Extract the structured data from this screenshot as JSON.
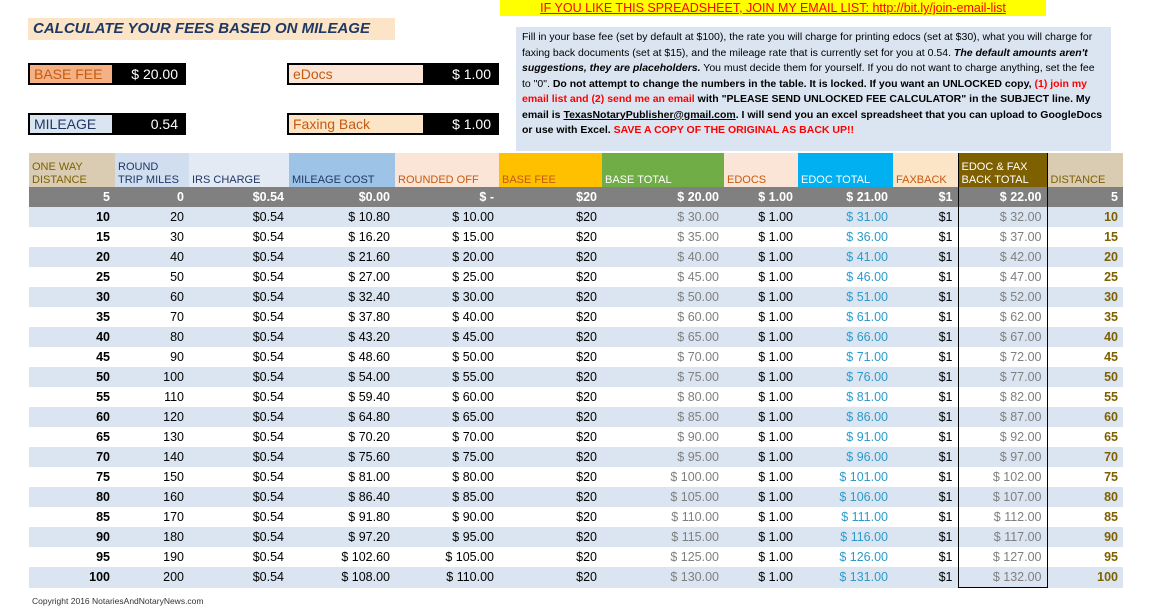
{
  "banner": "IF YOU LIKE THIS SPREADSHEET, JOIN MY EMAIL LIST:  http://bit.ly/join-email-list",
  "title": "CALCULATE YOUR FEES BASED ON MILEAGE",
  "inputs": {
    "base_fee": {
      "label": "BASE FEE",
      "value": "$ 20.00",
      "label_bg": "#f4b183",
      "label_color": "#c55a11"
    },
    "edocs": {
      "label": "eDocs",
      "value": "$ 1.00",
      "label_bg": "#fbe5d6",
      "label_color": "#c55a11"
    },
    "mileage": {
      "label": "MILEAGE",
      "value": "0.54",
      "label_bg": "#dbe5f1",
      "label_color": "#1f3864"
    },
    "faxing_back": {
      "label": "Faxing Back",
      "value": "$ 1.00",
      "label_bg": "#fce4c6",
      "label_color": "#c55a11"
    }
  },
  "description": {
    "p1": "Fill in your base fee (set by default at $100), the rate you will charge for printing edocs (set at $30), what you will charge for faxing back documents (set at $15), and the mileage rate that is currently set for you at 0.54.",
    "p2": "The default amounts aren't suggestions, they are placeholders.",
    "p3": "You must decide them for yourself. If you do not want to charge anything, set the fee to \"0\".",
    "p4": "Do not attempt to change the numbers in the table.  It is locked. If you want an UNLOCKED copy,",
    "p5": "(1) join my email list and (2) send me an email",
    "p6": "with \"PLEASE SEND UNLOCKED FEE CALCULATOR\" in the SUBJECT line. My email is",
    "email": "TexasNotaryPublisher@gmail.com",
    "p7": ".  I will send you an excel spreadsheet that you can upload to GoogleDocs or use with Excel.",
    "p8": "SAVE A COPY OF THE ORIGINAL AS BACK UP!!"
  },
  "table": {
    "headers": [
      {
        "label": "ONE WAY DISTANCE",
        "bg": "#d9ccb3",
        "color": "#7f6000"
      },
      {
        "label": "ROUND TRIP MILES",
        "bg": "#d0def0",
        "color": "#1f3864"
      },
      {
        "label": "IRS CHARGE",
        "bg": "#e4eaf4",
        "color": "#1f3864"
      },
      {
        "label": "MILEAGE COST",
        "bg": "#9dc3e6",
        "color": "#1f3864"
      },
      {
        "label": "ROUNDED OFF",
        "bg": "#fbe5d6",
        "color": "#c55a11"
      },
      {
        "label": "BASE FEE",
        "bg": "#ffc000",
        "color": "#c55a11"
      },
      {
        "label": "BASE TOTAL",
        "bg": "#70ad47",
        "color": "#ffffff"
      },
      {
        "label": "EDOCS",
        "bg": "#fbe5d6",
        "color": "#c55a11"
      },
      {
        "label": "EDOC TOTAL",
        "bg": "#00b0f0",
        "color": "#ffffff"
      },
      {
        "label": "FAXBACK",
        "bg": "#fce4c6",
        "color": "#c55a11"
      },
      {
        "label": "EDOC & FAX BACK TOTAL",
        "bg": "#7f6000",
        "color": "#ffffff"
      },
      {
        "label": "DISTANCE",
        "bg": "#d9ccb3",
        "color": "#7f6000"
      }
    ],
    "rows": [
      [
        "5",
        "0",
        "$0.54",
        "$0.00",
        "$ -",
        "$20",
        "$ 20.00",
        "$ 1.00",
        "$ 21.00",
        "$1",
        "$ 22.00",
        "5"
      ],
      [
        "10",
        "20",
        "$0.54",
        "$ 10.80",
        "$ 10.00",
        "$20",
        "$ 30.00",
        "$ 1.00",
        "$ 31.00",
        "$1",
        "$ 32.00",
        "10"
      ],
      [
        "15",
        "30",
        "$0.54",
        "$ 16.20",
        "$ 15.00",
        "$20",
        "$ 35.00",
        "$ 1.00",
        "$ 36.00",
        "$1",
        "$ 37.00",
        "15"
      ],
      [
        "20",
        "40",
        "$0.54",
        "$ 21.60",
        "$ 20.00",
        "$20",
        "$ 40.00",
        "$ 1.00",
        "$ 41.00",
        "$1",
        "$ 42.00",
        "20"
      ],
      [
        "25",
        "50",
        "$0.54",
        "$ 27.00",
        "$ 25.00",
        "$20",
        "$ 45.00",
        "$ 1.00",
        "$ 46.00",
        "$1",
        "$ 47.00",
        "25"
      ],
      [
        "30",
        "60",
        "$0.54",
        "$ 32.40",
        "$ 30.00",
        "$20",
        "$ 50.00",
        "$ 1.00",
        "$ 51.00",
        "$1",
        "$ 52.00",
        "30"
      ],
      [
        "35",
        "70",
        "$0.54",
        "$ 37.80",
        "$ 40.00",
        "$20",
        "$ 60.00",
        "$ 1.00",
        "$ 61.00",
        "$1",
        "$ 62.00",
        "35"
      ],
      [
        "40",
        "80",
        "$0.54",
        "$ 43.20",
        "$ 45.00",
        "$20",
        "$ 65.00",
        "$ 1.00",
        "$ 66.00",
        "$1",
        "$ 67.00",
        "40"
      ],
      [
        "45",
        "90",
        "$0.54",
        "$ 48.60",
        "$ 50.00",
        "$20",
        "$ 70.00",
        "$ 1.00",
        "$ 71.00",
        "$1",
        "$ 72.00",
        "45"
      ],
      [
        "50",
        "100",
        "$0.54",
        "$ 54.00",
        "$ 55.00",
        "$20",
        "$ 75.00",
        "$ 1.00",
        "$ 76.00",
        "$1",
        "$ 77.00",
        "50"
      ],
      [
        "55",
        "110",
        "$0.54",
        "$ 59.40",
        "$ 60.00",
        "$20",
        "$ 80.00",
        "$ 1.00",
        "$ 81.00",
        "$1",
        "$ 82.00",
        "55"
      ],
      [
        "60",
        "120",
        "$0.54",
        "$ 64.80",
        "$ 65.00",
        "$20",
        "$ 85.00",
        "$ 1.00",
        "$ 86.00",
        "$1",
        "$ 87.00",
        "60"
      ],
      [
        "65",
        "130",
        "$0.54",
        "$ 70.20",
        "$ 70.00",
        "$20",
        "$ 90.00",
        "$ 1.00",
        "$ 91.00",
        "$1",
        "$ 92.00",
        "65"
      ],
      [
        "70",
        "140",
        "$0.54",
        "$ 75.60",
        "$ 75.00",
        "$20",
        "$ 95.00",
        "$ 1.00",
        "$ 96.00",
        "$1",
        "$ 97.00",
        "70"
      ],
      [
        "75",
        "150",
        "$0.54",
        "$ 81.00",
        "$ 80.00",
        "$20",
        "$ 100.00",
        "$ 1.00",
        "$ 101.00",
        "$1",
        "$ 102.00",
        "75"
      ],
      [
        "80",
        "160",
        "$0.54",
        "$ 86.40",
        "$ 85.00",
        "$20",
        "$ 105.00",
        "$ 1.00",
        "$ 106.00",
        "$1",
        "$ 107.00",
        "80"
      ],
      [
        "85",
        "170",
        "$0.54",
        "$ 91.80",
        "$ 90.00",
        "$20",
        "$ 110.00",
        "$ 1.00",
        "$ 111.00",
        "$1",
        "$ 112.00",
        "85"
      ],
      [
        "90",
        "180",
        "$0.54",
        "$ 97.20",
        "$ 95.00",
        "$20",
        "$ 115.00",
        "$ 1.00",
        "$ 116.00",
        "$1",
        "$ 117.00",
        "90"
      ],
      [
        "95",
        "190",
        "$0.54",
        "$ 102.60",
        "$ 105.00",
        "$20",
        "$ 125.00",
        "$ 1.00",
        "$ 126.00",
        "$1",
        "$ 127.00",
        "95"
      ],
      [
        "100",
        "200",
        "$0.54",
        "$ 108.00",
        "$ 110.00",
        "$20",
        "$ 130.00",
        "$ 1.00",
        "$ 131.00",
        "$1",
        "$ 132.00",
        "100"
      ]
    ]
  },
  "copyright": "Copyright 2016 NotariesAndNotaryNews.com"
}
